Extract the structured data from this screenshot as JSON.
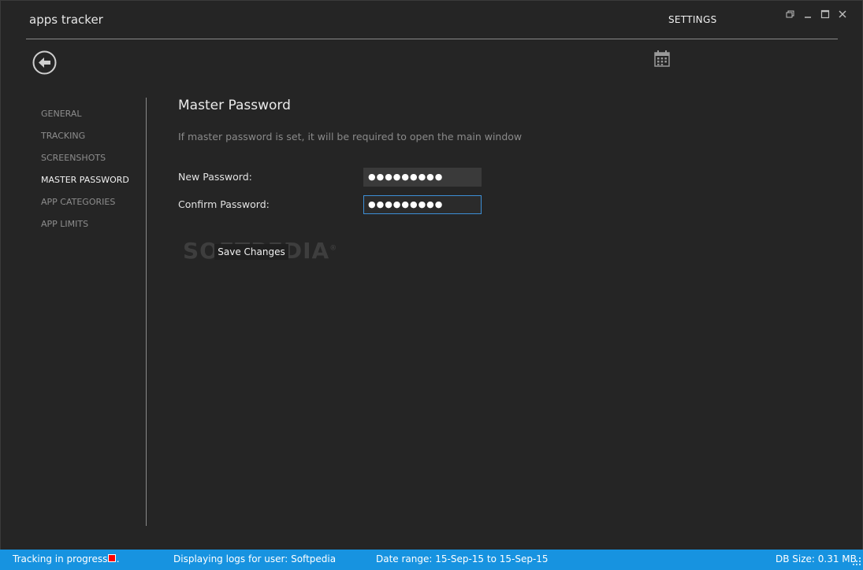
{
  "window": {
    "app_title": "apps tracker",
    "page_title": "SETTINGS",
    "controls": [
      "restore-icon",
      "minimize-icon",
      "maximize-icon",
      "close-icon"
    ]
  },
  "toolbar": {
    "back_icon": "back-arrow-icon",
    "calendar_icon": "calendar-icon"
  },
  "sidebar": {
    "items": [
      {
        "label": "GENERAL",
        "active": false
      },
      {
        "label": "TRACKING",
        "active": false
      },
      {
        "label": "SCREENSHOTS",
        "active": false
      },
      {
        "label": "MASTER PASSWORD",
        "active": true
      },
      {
        "label": "APP CATEGORIES",
        "active": false
      },
      {
        "label": "APP LIMITS",
        "active": false
      }
    ]
  },
  "main": {
    "title": "Master Password",
    "description": "If master password is set, it will be required to open the main window",
    "new_password_label": "New Password:",
    "new_password_value": "●●●●●●●●●",
    "confirm_password_label": "Confirm Password:",
    "confirm_password_value": "●●●●●●●●●",
    "save_label": "Save Changes"
  },
  "watermark": "SOFTPEDIA",
  "statusbar": {
    "tracking": "Tracking in progress ...",
    "user": "Displaying logs for user: Softpedia",
    "date_range": "Date range: 15-Sep-15 to 15-Sep-15",
    "db_size": "DB Size: 0.31 MB"
  },
  "colors": {
    "background": "#252525",
    "accent": "#1793e0",
    "focus_border": "#3d8fd6",
    "stop_indicator": "#ff0000"
  }
}
